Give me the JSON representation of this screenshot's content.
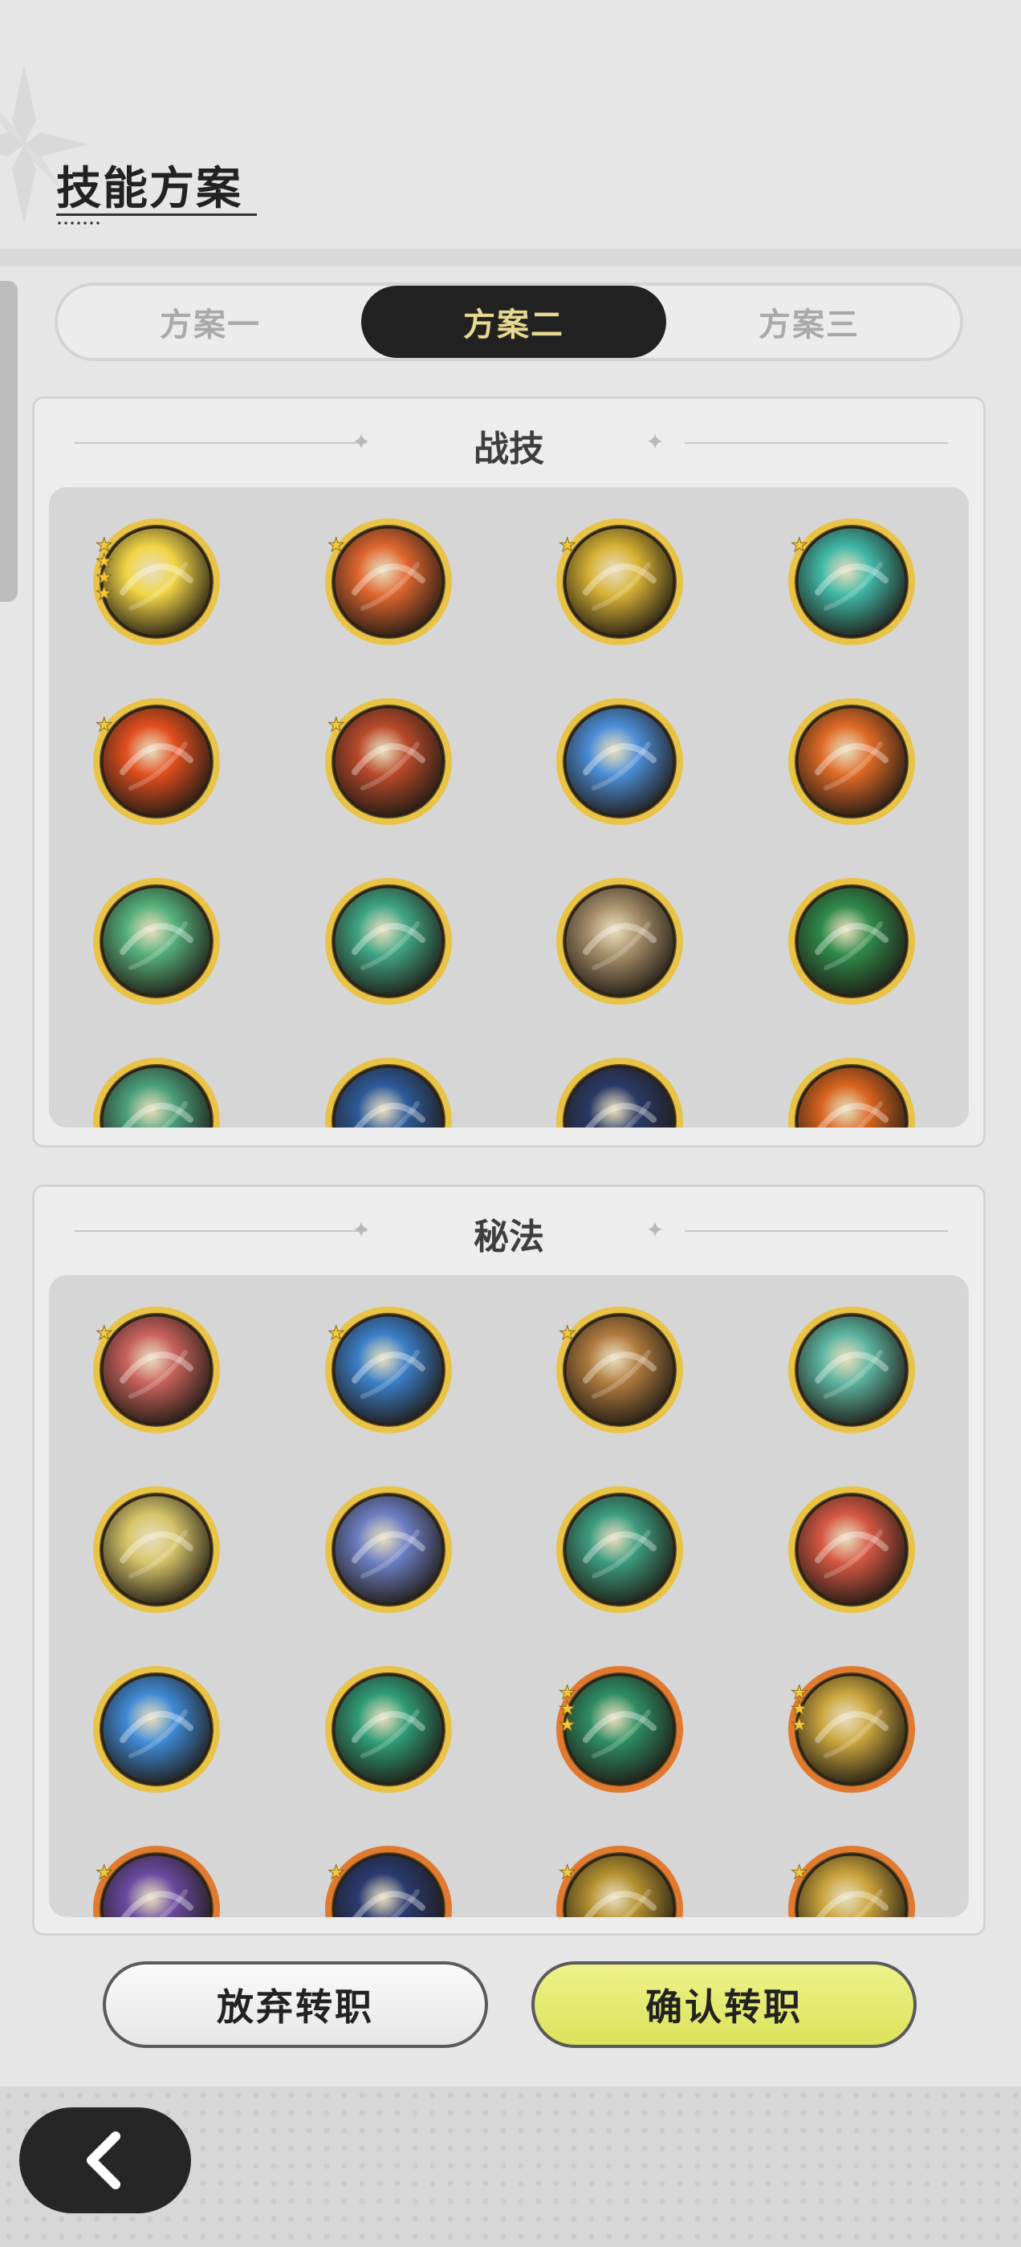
{
  "header": {
    "title": "技能方案"
  },
  "tabs": [
    {
      "label": "方案一",
      "active": false
    },
    {
      "label": "方案二",
      "active": true
    },
    {
      "label": "方案三",
      "active": false
    }
  ],
  "combat_section": {
    "title": "战技",
    "skills": [
      {
        "icon": "lightning-orb-icon",
        "stars": 4,
        "color": "#f1d546"
      },
      {
        "icon": "fire-swirl-icon",
        "stars": 1,
        "color": "#e0662f"
      },
      {
        "icon": "golden-diamond-icon",
        "stars": 1,
        "color": "#d7b234"
      },
      {
        "icon": "wind-vortex-icon",
        "stars": 1,
        "color": "#3fb8a7"
      },
      {
        "icon": "fireball-icon",
        "stars": 1,
        "color": "#e24f1f"
      },
      {
        "icon": "meteor-icon",
        "stars": 1,
        "color": "#b94a2a"
      },
      {
        "icon": "ice-burst-icon",
        "stars": 0,
        "color": "#4c8ed8"
      },
      {
        "icon": "flame-rune-icon",
        "stars": 0,
        "color": "#e06a26"
      },
      {
        "icon": "wind-sphere-icon",
        "stars": 0,
        "color": "#55b07a"
      },
      {
        "icon": "wind-slash-icon",
        "stars": 0,
        "color": "#3fa584"
      },
      {
        "icon": "cards-icon",
        "stars": 0,
        "color": "#a78f6a"
      },
      {
        "icon": "healing-plus-icon",
        "stars": 0,
        "color": "#2f8a4a"
      },
      {
        "icon": "wind-partial-icon",
        "stars": 0,
        "color": "#4aa07a"
      },
      {
        "icon": "water-partial-icon",
        "stars": 0,
        "color": "#2e5a9a"
      },
      {
        "icon": "ice-spike-partial-icon",
        "stars": 0,
        "color": "#2a3a66"
      },
      {
        "icon": "fire-partial-icon",
        "stars": 0,
        "color": "#d9641f"
      }
    ]
  },
  "secret_section": {
    "title": "秘法",
    "skills": [
      {
        "icon": "red-orb-icon",
        "stars": 1,
        "color": "#c8625c",
        "ring": "gold"
      },
      {
        "icon": "crystal-icon",
        "stars": 1,
        "color": "#3b7fc9",
        "ring": "gold"
      },
      {
        "icon": "wand-icon",
        "stars": 1,
        "color": "#b07b3f",
        "ring": "gold"
      },
      {
        "icon": "shield-icon",
        "stars": 0,
        "color": "#5cb4a0",
        "ring": "gold"
      },
      {
        "icon": "light-figure-icon",
        "stars": 0,
        "color": "#d6c469",
        "ring": "gold"
      },
      {
        "icon": "blue-armor-icon",
        "stars": 0,
        "color": "#6d7fc4",
        "ring": "gold"
      },
      {
        "icon": "green-star-icon",
        "stars": 0,
        "color": "#3c9c7f",
        "ring": "gold"
      },
      {
        "icon": "red-figure-icon",
        "stars": 0,
        "color": "#d65844",
        "ring": "gold"
      },
      {
        "icon": "blue-figure-icon",
        "stars": 0,
        "color": "#3f8ad6",
        "ring": "gold"
      },
      {
        "icon": "green-figure-icon",
        "stars": 0,
        "color": "#2f9c77",
        "ring": "gold"
      },
      {
        "icon": "heart-icon",
        "stars": 3,
        "color": "#2e8d63",
        "ring": "orange"
      },
      {
        "icon": "wing-icon",
        "stars": 3,
        "color": "#caa63e",
        "ring": "orange"
      },
      {
        "icon": "purple-partial-icon",
        "stars": 1,
        "color": "#6a4aa0",
        "ring": "orange"
      },
      {
        "icon": "navy-partial-icon",
        "stars": 1,
        "color": "#2a3a70",
        "ring": "orange"
      },
      {
        "icon": "gold-partial-icon",
        "stars": 1,
        "color": "#b3902f",
        "ring": "orange"
      },
      {
        "icon": "gold-crown-partial-icon",
        "stars": 1,
        "color": "#c9a23a",
        "ring": "orange"
      }
    ]
  },
  "actions": {
    "cancel_label": "放弃转职",
    "confirm_label": "确认转职"
  },
  "nav": {
    "back_icon": "chevron-left-icon"
  }
}
